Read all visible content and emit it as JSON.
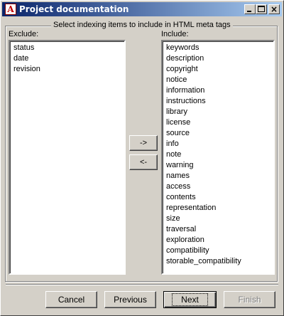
{
  "window": {
    "title": "Project documentation"
  },
  "groupbox": {
    "title": "Select indexing items to include in HTML meta tags"
  },
  "exclude": {
    "label": "Exclude:",
    "items": [
      "status",
      "date",
      "revision"
    ]
  },
  "include": {
    "label": "Include:",
    "items": [
      "keywords",
      "description",
      "copyright",
      "notice",
      "information",
      "instructions",
      "library",
      "license",
      "source",
      "info",
      "note",
      "warning",
      "names",
      "access",
      "contents",
      "representation",
      "size",
      "traversal",
      "exploration",
      "compatibility",
      "storable_compatibility"
    ]
  },
  "move_buttons": {
    "to_include": "->",
    "to_exclude": "<-"
  },
  "footer": {
    "cancel": "Cancel",
    "previous": "Previous",
    "next": "Next",
    "finish": "Finish"
  },
  "colors": {
    "titlebar_start": "#0a246a",
    "titlebar_end": "#a6caf0",
    "face": "#d4d0c8"
  }
}
